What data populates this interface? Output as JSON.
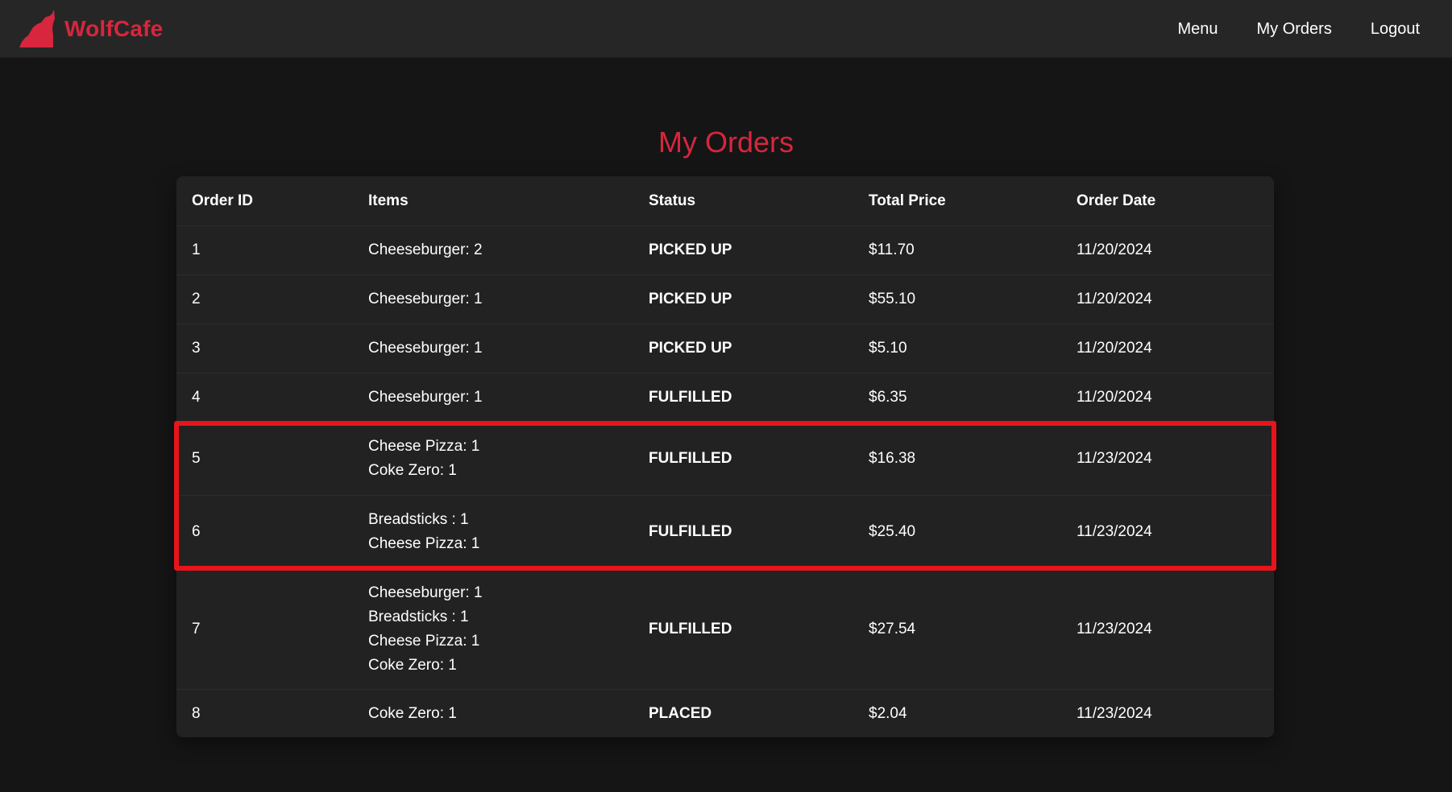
{
  "header": {
    "brand": "WolfCafe",
    "logo_icon": "wolf-howling-icon",
    "brand_color": "#d7263d",
    "nav": [
      "Menu",
      "My Orders",
      "Logout"
    ]
  },
  "page": {
    "title": "My Orders"
  },
  "table": {
    "columns": [
      "Order ID",
      "Items",
      "Status",
      "Total Price",
      "Order Date"
    ],
    "rows": [
      {
        "id": "1",
        "items": [
          "Cheeseburger: 2"
        ],
        "status": "PICKED UP",
        "total": "$11.70",
        "date": "11/20/2024"
      },
      {
        "id": "2",
        "items": [
          "Cheeseburger: 1"
        ],
        "status": "PICKED UP",
        "total": "$55.10",
        "date": "11/20/2024"
      },
      {
        "id": "3",
        "items": [
          "Cheeseburger: 1"
        ],
        "status": "PICKED UP",
        "total": "$5.10",
        "date": "11/20/2024"
      },
      {
        "id": "4",
        "items": [
          "Cheeseburger: 1"
        ],
        "status": "FULFILLED",
        "total": "$6.35",
        "date": "11/20/2024"
      },
      {
        "id": "5",
        "items": [
          "Cheese Pizza: 1",
          "Coke Zero: 1"
        ],
        "status": "FULFILLED",
        "total": "$16.38",
        "date": "11/23/2024"
      },
      {
        "id": "6",
        "items": [
          "Breadsticks : 1",
          "Cheese Pizza: 1"
        ],
        "status": "FULFILLED",
        "total": "$25.40",
        "date": "11/23/2024"
      },
      {
        "id": "7",
        "items": [
          "Cheeseburger: 1",
          "Breadsticks : 1",
          "Cheese Pizza: 1",
          "Coke Zero: 1"
        ],
        "status": "FULFILLED",
        "total": "$27.54",
        "date": "11/23/2024"
      },
      {
        "id": "8",
        "items": [
          "Coke Zero: 1"
        ],
        "status": "PLACED",
        "total": "$2.04",
        "date": "11/23/2024"
      }
    ]
  },
  "highlight": {
    "color": "#e8141b",
    "rows": [
      "5",
      "6"
    ]
  }
}
